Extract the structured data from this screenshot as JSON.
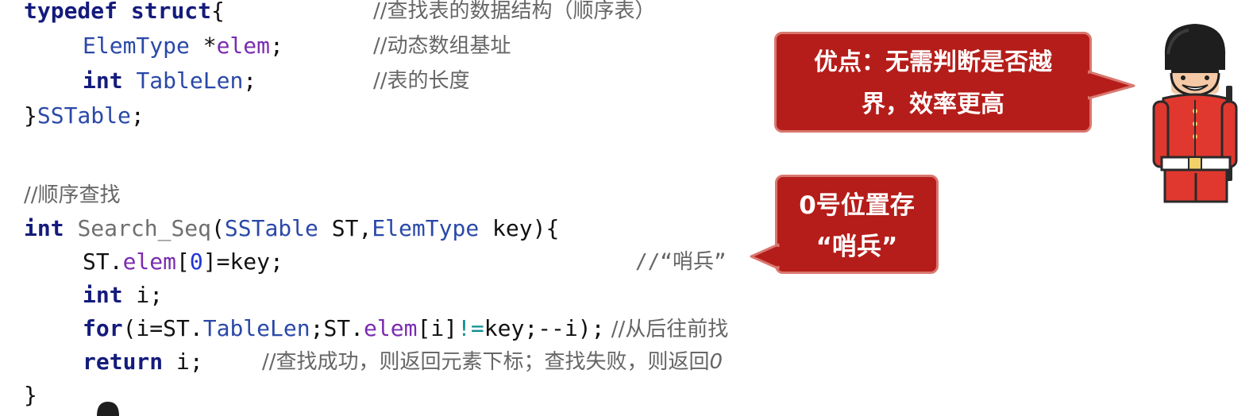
{
  "code": {
    "struct": {
      "typedef": "typedef",
      "struct_kw": "struct",
      "open_brace": "{",
      "comment1": "//查找表的数据结构（顺序表）",
      "field1_type": "ElemType",
      "field1_name": " *elem;",
      "field1_name_star": " *",
      "field1_name_id": "elem",
      "field1_semicolon": ";",
      "comment2": "//动态数组基址",
      "field2_type": "int",
      "field2_name": "TableLen",
      "field2_semicolon": ";",
      "comment3": "//表的长度",
      "close_brace": "}",
      "typename": "SSTable",
      "close_semicolon": ";"
    },
    "func": {
      "comment": "//顺序查找",
      "ret_type": "int",
      "name": "Search_Seq",
      "paren_open": "(",
      "p1_type": "SSTable",
      "p1_name": " ST,",
      "p2_type": "ElemType",
      "p2_name": " key){",
      "stmt1_a": "ST.",
      "stmt1_mem": "elem",
      "stmt1_b": "[",
      "stmt1_num": "0",
      "stmt1_c": "]=key;",
      "stmt1_comment": "//“哨兵”",
      "stmt2_kw": "int",
      "stmt2_rest": " i;",
      "stmt3_kw": "for",
      "stmt3_a": "(i=ST.",
      "stmt3_mem1": "TableLen",
      "stmt3_b": ";ST.",
      "stmt3_mem2": "elem",
      "stmt3_c": "[i]",
      "stmt3_neq": "!=",
      "stmt3_d": "key;--i);",
      "stmt3_comment": " //从后往前找",
      "stmt4_kw": "return",
      "stmt4_rest": " i;",
      "stmt4_comment": "//查找成功，则返回元素下标；查找失败，则返回",
      "stmt4_comment_end": "0",
      "close_brace": "}"
    }
  },
  "callouts": {
    "advantage_line1": "优点：无需判断是否越",
    "advantage_line2": "界，效率更高",
    "sentinel_line1": "0号位置存",
    "sentinel_line2": "“哨兵”"
  },
  "colors": {
    "keyword": "#141b7c",
    "type": "#2a48a8",
    "member": "#7a2bb0",
    "bubble": "#b51d1a"
  },
  "icons": {
    "guard": "royal-guard-icon"
  }
}
